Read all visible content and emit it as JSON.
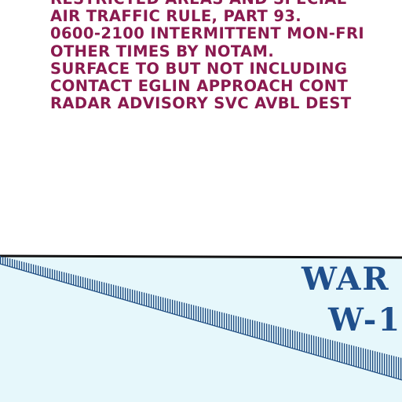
{
  "chart_note": {
    "lines": [
      "RESTRICTED AREAS AND SPECIAL",
      "AIR TRAFFIC RULE, PART 93.",
      "0600-2100 INTERMITTENT MON-FRI",
      "OTHER TIMES BY NOTAM.",
      "SURFACE TO BUT NOT INCLUDING",
      "CONTACT EGLIN APPROACH CONT",
      "RADAR ADVISORY SVC AVBL DEST"
    ]
  },
  "warning_area": {
    "name": "WAR",
    "id": "W-1"
  },
  "colors": {
    "note_text": "#8a1a4f",
    "area_label": "#1f4f8c",
    "warning_area_fill": "#e6f7fb",
    "boundary": "#111111",
    "hatch": "#1c4a80"
  }
}
